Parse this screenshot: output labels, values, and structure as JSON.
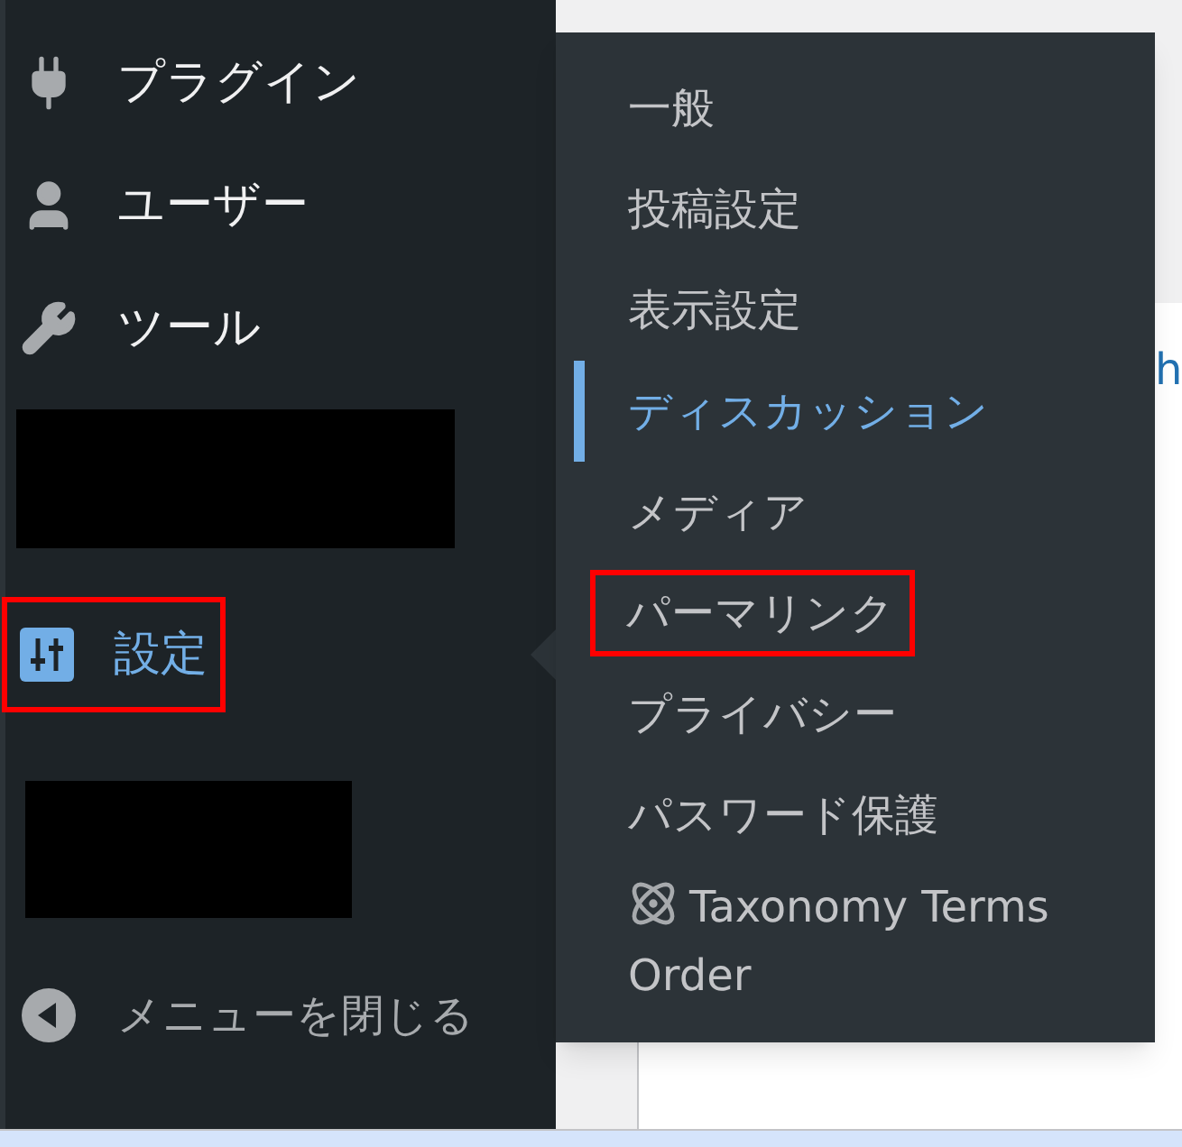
{
  "sidebar": {
    "items": [
      {
        "kind": "menu",
        "label": "プラグイン",
        "selected": false,
        "highlighted": false
      },
      {
        "kind": "menu",
        "label": "ユーザー",
        "selected": false,
        "highlighted": false
      },
      {
        "kind": "menu",
        "label": "ツール",
        "selected": false,
        "highlighted": false
      },
      {
        "kind": "redacted"
      },
      {
        "kind": "menu",
        "label": "設定",
        "selected": true,
        "highlighted": true
      },
      {
        "kind": "redacted"
      },
      {
        "kind": "collapse",
        "label": "メニューを閉じる"
      }
    ]
  },
  "submenu": {
    "items": [
      {
        "label": "一般",
        "selected": false,
        "highlighted": false
      },
      {
        "label": "投稿設定",
        "selected": false,
        "highlighted": false
      },
      {
        "label": "表示設定",
        "selected": false,
        "highlighted": false
      },
      {
        "label": "ディスカッション",
        "selected": true,
        "highlighted": false
      },
      {
        "label": "メディア",
        "selected": false,
        "highlighted": false
      },
      {
        "label": "パーマリンク",
        "selected": false,
        "highlighted": true
      },
      {
        "label": "プライバシー",
        "selected": false,
        "highlighted": false
      },
      {
        "label": "パスワード保護",
        "selected": false,
        "highlighted": false
      },
      {
        "kind": "plugin",
        "label": "Taxonomy Terms Order",
        "selected": false,
        "highlighted": false
      }
    ]
  },
  "content": {
    "link_fragment": "h"
  }
}
